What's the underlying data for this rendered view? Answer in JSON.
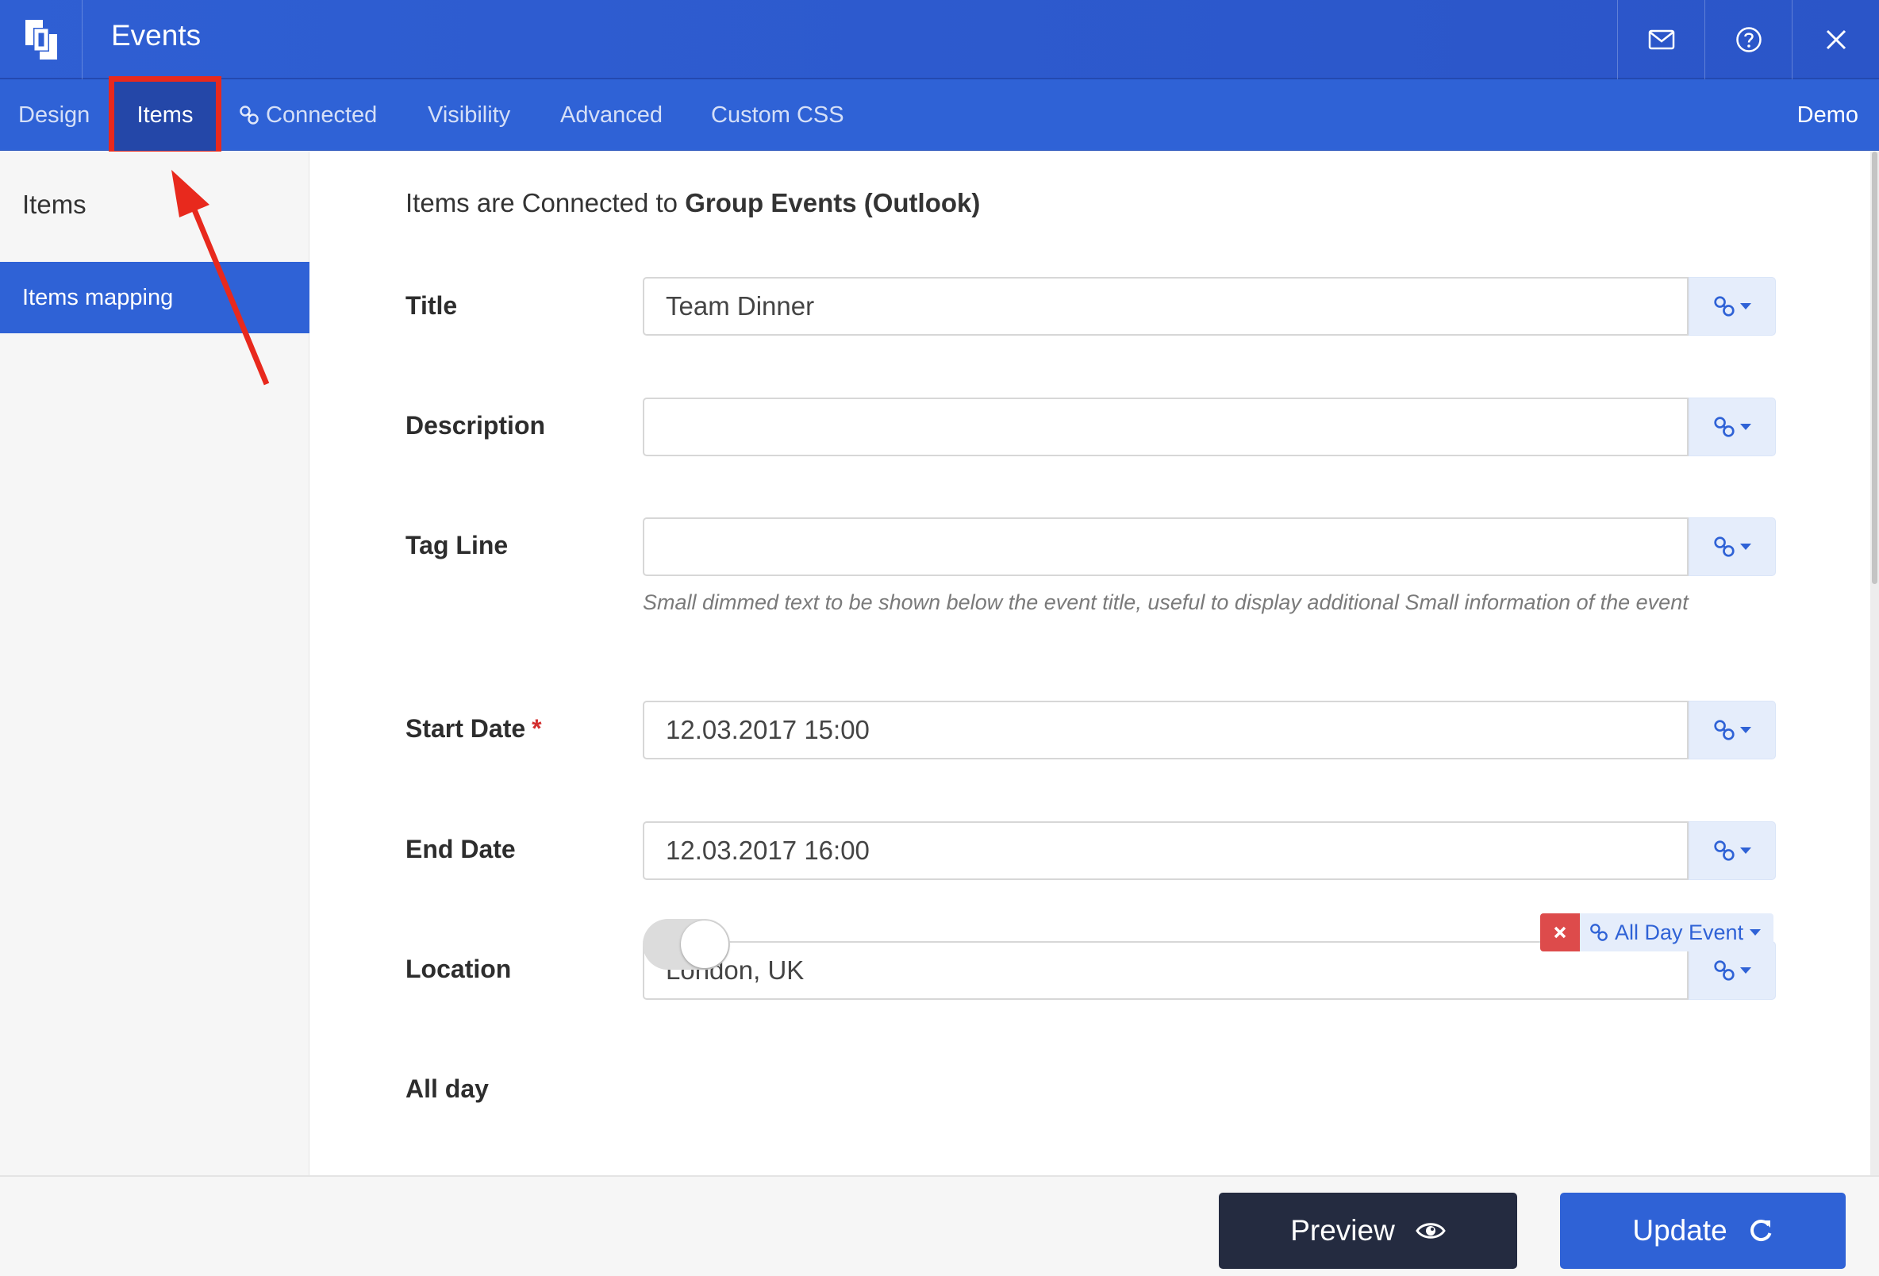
{
  "header": {
    "title": "Events"
  },
  "tabs": [
    {
      "label": "Design"
    },
    {
      "label": "Items"
    },
    {
      "label": "Connected"
    },
    {
      "label": "Visibility"
    },
    {
      "label": "Advanced"
    },
    {
      "label": "Custom CSS"
    }
  ],
  "active_tab": "Items",
  "tab_right": "Demo",
  "sidebar": {
    "heading": "Items",
    "items": [
      {
        "label": "Items mapping",
        "active": true
      }
    ]
  },
  "main": {
    "intro_prefix": "Items are Connected to ",
    "intro_source": "Group Events (Outlook)",
    "fields": [
      {
        "label": "Title",
        "value": "Team Dinner",
        "required": false
      },
      {
        "label": "Description",
        "value": "",
        "required": false
      },
      {
        "label": "Tag Line",
        "value": "",
        "required": false,
        "help": "Small dimmed text to be shown below the event title, useful to display additional Small information of the event"
      },
      {
        "label": "Start Date",
        "value": "12.03.2017 15:00",
        "required": true
      },
      {
        "label": "End Date",
        "value": "12.03.2017 16:00",
        "required": false
      },
      {
        "label": "Location",
        "value": "London, UK",
        "required": false
      },
      {
        "label": "All day",
        "toggle": false,
        "mapped_to": "All Day Event"
      }
    ],
    "required_mark": "*"
  },
  "footer": {
    "preview_label": "Preview",
    "update_label": "Update"
  },
  "colors": {
    "primary": "#2f62d6",
    "header": "#2f5fd3",
    "active_tab": "#2447a8",
    "annotation": "#e8291d",
    "preview_button": "#242b40",
    "danger": "#dd4b4b"
  },
  "icons": [
    "logo-icon",
    "mail-icon",
    "help-icon",
    "close-icon",
    "link-icon",
    "eye-icon",
    "refresh-icon",
    "x-icon"
  ]
}
